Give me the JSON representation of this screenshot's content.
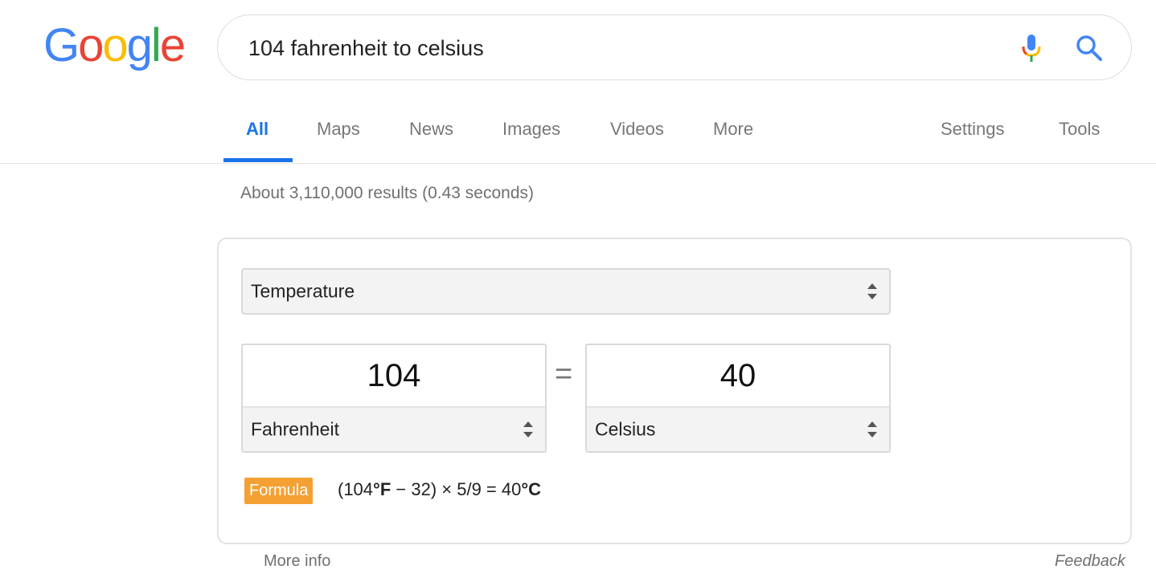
{
  "logo": {
    "letters": [
      "G",
      "o",
      "o",
      "g",
      "l",
      "e"
    ],
    "colors": [
      "#4285F4",
      "#EA4335",
      "#FBBC05",
      "#4285F4",
      "#34A853",
      "#EA4335"
    ]
  },
  "search": {
    "query": "104 fahrenheit to celsius",
    "mic_icon": "microphone-icon",
    "search_icon": "search-icon"
  },
  "tabs": {
    "items": [
      {
        "label": "All",
        "active": true
      },
      {
        "label": "Maps"
      },
      {
        "label": "News"
      },
      {
        "label": "Images"
      },
      {
        "label": "Videos"
      },
      {
        "label": "More"
      }
    ],
    "settings": "Settings",
    "tools": "Tools",
    "accent": "#1a73e8"
  },
  "result_stats": "About 3,110,000 results (0.43 seconds)",
  "converter": {
    "category": "Temperature",
    "from_value": "104",
    "from_unit": "Fahrenheit",
    "to_value": "40",
    "to_unit": "Celsius",
    "equals": "=",
    "formula_label": "Formula",
    "formula_label_color": "#f4a032",
    "formula_parts": {
      "p1": "(104",
      "p2": "°F",
      "p3": " − 32) × 5/9 = 40",
      "p4": "°C"
    }
  },
  "footer": {
    "more_info": "More info",
    "feedback": "Feedback"
  }
}
